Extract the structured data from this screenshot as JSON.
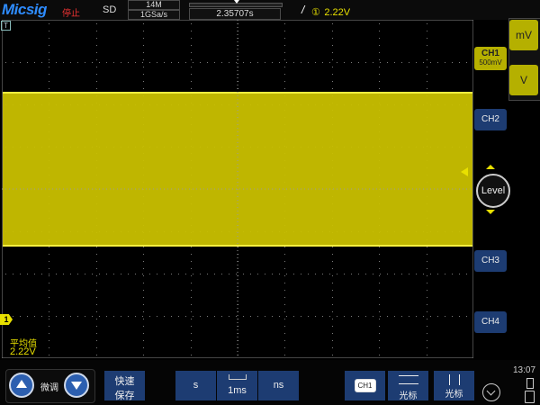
{
  "header": {
    "logo": "Micsig",
    "run_status": "停止",
    "mode": "SD",
    "memory_depth": "14M",
    "sample_rate": "1GSa/s",
    "horizontal_position": "2.35707s",
    "trigger_slope": "/",
    "trigger_source": "①",
    "trigger_level": "2.22V"
  },
  "channels": {
    "ch1_label": "CH1",
    "ch1_scale": "500mV",
    "ch2_label": "CH2",
    "ch3_label": "CH3",
    "ch4_label": "CH4",
    "ch1_marker": "1",
    "colors": {
      "ch1": "#e8e000",
      "ch_inactive": "#1d3c72"
    }
  },
  "right_panel": {
    "unit_mv": "mV",
    "unit_v": "V",
    "level_label": "Level"
  },
  "measurement": {
    "name": "平均值",
    "value": "2.22V"
  },
  "bottom": {
    "fine_label": "微调",
    "quick_save_line1": "快速",
    "quick_save_line2": "保存",
    "timebase_s": "s",
    "timebase_value": "1ms",
    "timebase_ns": "ns",
    "ch1_btn": "CH1",
    "cursor_h": "光标",
    "cursor_v": "光标",
    "time": "13:07"
  }
}
